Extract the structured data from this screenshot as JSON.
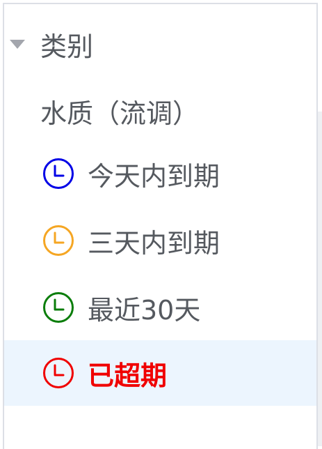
{
  "category": {
    "label": "类别"
  },
  "items": [
    {
      "label": "水质（流调）",
      "icon": null,
      "color": "#55595f"
    },
    {
      "label": "今天内到期",
      "icon": "clock-icon",
      "color": "#0000e6"
    },
    {
      "label": "三天内到期",
      "icon": "clock-icon",
      "color": "#f5a623"
    },
    {
      "label": "最近30天",
      "icon": "clock-icon",
      "color": "#0a7d0a"
    },
    {
      "label": "已超期",
      "icon": "clock-icon",
      "color": "#f00000"
    }
  ],
  "colors": {
    "selected_bg": "#ecf5fe",
    "text": "#55595f",
    "caret": "#a3a6ad"
  }
}
